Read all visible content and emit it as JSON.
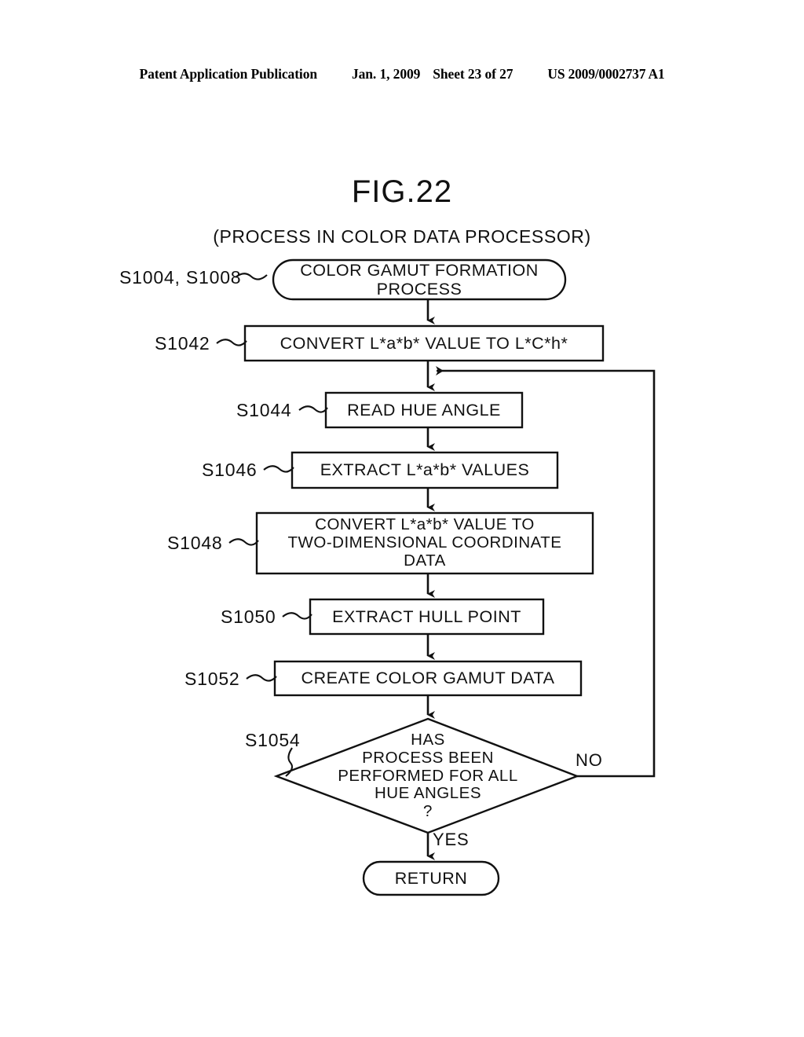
{
  "header": {
    "publication": "Patent Application Publication",
    "date": "Jan. 1, 2009",
    "sheet": "Sheet 23 of 27",
    "patent_number": "US 2009/0002737 A1"
  },
  "figure": {
    "title": "FIG.22",
    "subtitle": "(PROCESS IN COLOR DATA PROCESSOR)"
  },
  "flowchart": {
    "nodes": [
      {
        "id": "start",
        "shape": "terminator",
        "step": "S1004, S1008",
        "text": "COLOR GAMUT FORMATION\nPROCESS"
      },
      {
        "id": "s1042",
        "shape": "process",
        "step": "S1042",
        "text": "CONVERT L*a*b* VALUE TO L*C*h*"
      },
      {
        "id": "s1044",
        "shape": "process",
        "step": "S1044",
        "text": "READ HUE ANGLE"
      },
      {
        "id": "s1046",
        "shape": "process",
        "step": "S1046",
        "text": "EXTRACT L*a*b* VALUES"
      },
      {
        "id": "s1048",
        "shape": "process",
        "step": "S1048",
        "text": "CONVERT L*a*b* VALUE TO\nTWO-DIMENSIONAL COORDINATE\nDATA"
      },
      {
        "id": "s1050",
        "shape": "process",
        "step": "S1050",
        "text": "EXTRACT HULL POINT"
      },
      {
        "id": "s1052",
        "shape": "process",
        "step": "S1052",
        "text": "CREATE COLOR GAMUT DATA"
      },
      {
        "id": "s1054",
        "shape": "decision",
        "step": "S1054",
        "text": "HAS\nPROCESS BEEN\nPERFORMED FOR ALL\nHUE ANGLES\n?"
      },
      {
        "id": "return",
        "shape": "terminator",
        "step": "",
        "text": "RETURN"
      }
    ],
    "branches": {
      "no": "NO",
      "yes": "YES"
    }
  }
}
